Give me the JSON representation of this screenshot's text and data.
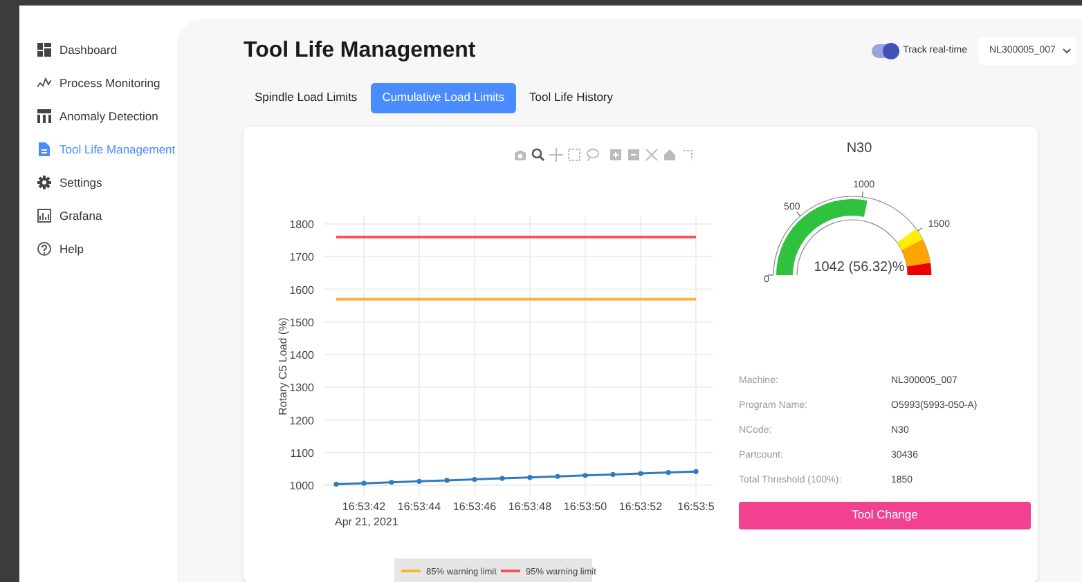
{
  "sidebar": {
    "items": [
      {
        "label": "Dashboard",
        "selected": false
      },
      {
        "label": "Process Monitoring",
        "selected": false
      },
      {
        "label": "Anomaly Detection",
        "selected": false
      },
      {
        "label": "Tool Life Management",
        "selected": true
      },
      {
        "label": "Settings",
        "selected": false
      },
      {
        "label": "Grafana",
        "selected": false
      },
      {
        "label": "Help",
        "selected": false
      }
    ]
  },
  "header": {
    "title": "Tool Life Management",
    "toggle": {
      "label": "Track real-time",
      "on": true
    },
    "machine_select": {
      "value": "NL300005_007"
    }
  },
  "tabs": [
    {
      "label": "Spindle Load Limits",
      "selected": false
    },
    {
      "label": "Cumulative Load Limits",
      "selected": true
    },
    {
      "label": "Tool Life History",
      "selected": false
    }
  ],
  "chart": {
    "date_label": "Apr 21, 2021",
    "chart_data": {
      "type": "line",
      "grid": true,
      "legend": true,
      "ylabel": "Rotary C5 Load (%)",
      "categories": [
        null,
        "16:53:42",
        null,
        "16:53:44",
        null,
        "16:53:46",
        null,
        "16:53:48",
        null,
        "16:53:50",
        null,
        "16:53:52",
        null,
        "16:53:5"
      ],
      "ylim": [
        1000,
        1800
      ],
      "yticks": [
        1000,
        1100,
        1200,
        1300,
        1400,
        1500,
        1600,
        1700,
        1800
      ],
      "series": [
        {
          "color": "#2f7bbf",
          "marker": true,
          "values": [
            1003,
            1006,
            1009,
            1012,
            1015,
            1018,
            1021,
            1024,
            1027,
            1030,
            1033,
            1036,
            1039,
            1042
          ]
        },
        {
          "name": "85% warning limit",
          "color": "#fbb13c",
          "values": [
            1570,
            1570,
            1570,
            1570,
            1570,
            1570,
            1570,
            1570,
            1570,
            1570,
            1570,
            1570,
            1570,
            1570
          ]
        },
        {
          "name": "95% warning limit",
          "color": "#f2545b",
          "values": [
            1760,
            1760,
            1760,
            1760,
            1760,
            1760,
            1760,
            1760,
            1760,
            1760,
            1760,
            1760,
            1760,
            1760
          ]
        }
      ]
    }
  },
  "gauge": {
    "title": "N30",
    "level": 0.5632,
    "reading": "1042 (56.32)%",
    "ticks": [
      "0",
      "500",
      "1000",
      "1500"
    ]
  },
  "info": [
    {
      "label": "Machine:",
      "value": "NL300005_007"
    },
    {
      "label": "Program Name:",
      "value": "O5993(5993-050-A)"
    },
    {
      "label": "NCode:",
      "value": "N30"
    },
    {
      "label": "Partcount:",
      "value": "30436"
    },
    {
      "label": "Total Threshold (100%):",
      "value": "1850"
    }
  ],
  "action_button": "Tool Change"
}
